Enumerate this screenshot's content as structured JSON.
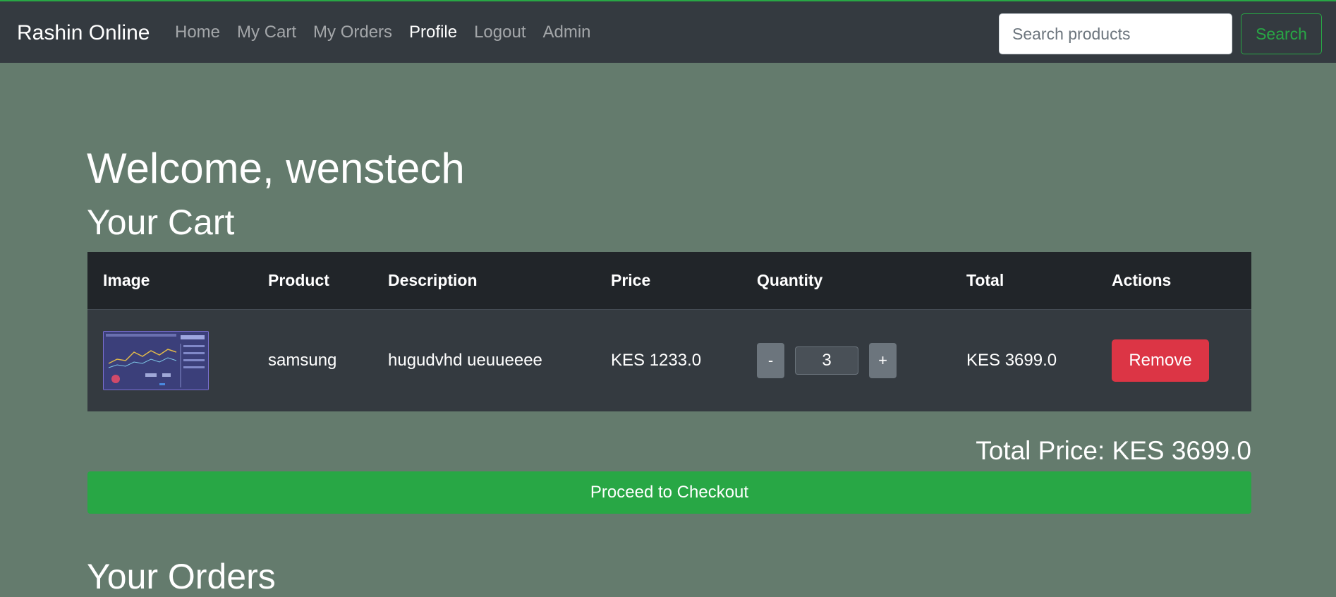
{
  "navbar": {
    "brand": "Rashin Online",
    "links": [
      {
        "label": "Home",
        "active": false
      },
      {
        "label": "My Cart",
        "active": false
      },
      {
        "label": "My Orders",
        "active": false
      },
      {
        "label": "Profile",
        "active": true
      },
      {
        "label": "Logout",
        "active": false
      },
      {
        "label": "Admin",
        "active": false
      }
    ],
    "search_placeholder": "Search products",
    "search_value": "",
    "search_button": "Search"
  },
  "main": {
    "welcome": "Welcome, wenstech",
    "cart_heading": "Your Cart",
    "table": {
      "headers": [
        "Image",
        "Product",
        "Description",
        "Price",
        "Quantity",
        "Total",
        "Actions"
      ],
      "rows": [
        {
          "image_icon": "product-thumbnail",
          "product": "samsung",
          "description": "hugudvhd ueuueeee",
          "price": "KES 1233.0",
          "decrement_label": "-",
          "quantity": "3",
          "increment_label": "+",
          "total": "KES 3699.0",
          "action_label": "Remove"
        }
      ]
    },
    "total_price": "Total Price: KES 3699.0",
    "checkout_button": "Proceed to Checkout",
    "orders_heading": "Your Orders"
  },
  "colors": {
    "page_background": "#647b6d",
    "navbar_background": "#343a40",
    "table_header": "#212529",
    "table_row": "#343a40",
    "success": "#28a745",
    "danger": "#dc3545",
    "secondary": "#6c757d"
  }
}
